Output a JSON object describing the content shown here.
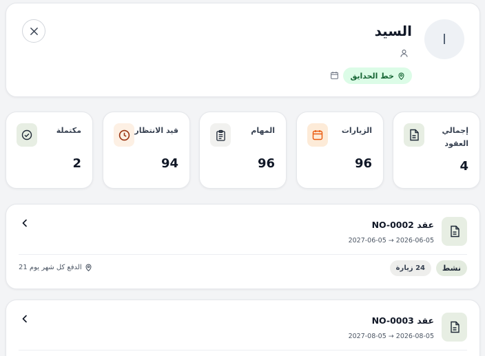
{
  "customer": {
    "avatar_initial": "ا",
    "name": "السيد",
    "route": "خط الحدايق"
  },
  "stats": {
    "total": {
      "label": "إجمالي العقود",
      "value": "4"
    },
    "visits": {
      "label": "الزيارات",
      "value": "96"
    },
    "tasks": {
      "label": "المهام",
      "value": "96"
    },
    "pending": {
      "label": "قيد الانتظار",
      "value": "94"
    },
    "completed": {
      "label": "مكتملة",
      "value": "2"
    }
  },
  "contracts": [
    {
      "title": "عقد NO-0002",
      "dates": "2026-06-05 → 2027-06-05",
      "status": "نشط",
      "visits": "24 زيارة",
      "payment": "الدفع كل شهر يوم 21"
    },
    {
      "title": "عقد NO-0003",
      "dates": "2026-08-05 → 2027-08-05"
    }
  ],
  "colors": {
    "accent_green": "#166534",
    "route_badge_bg": "#dcfce7",
    "visits_icon": "#ea580c",
    "pending_icon": "#9a3412"
  }
}
